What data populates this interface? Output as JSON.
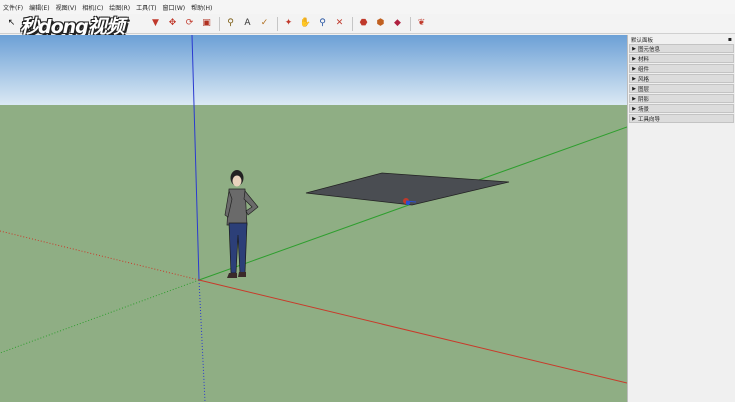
{
  "menubar": {
    "items": [
      {
        "label": "文件(F)"
      },
      {
        "label": "编辑(E)"
      },
      {
        "label": "视图(V)"
      },
      {
        "label": "相机(C)"
      },
      {
        "label": "绘图(R)"
      },
      {
        "label": "工具(T)"
      },
      {
        "label": "窗口(W)"
      },
      {
        "label": "帮助(H)"
      }
    ]
  },
  "toolbar": {
    "tools": [
      {
        "icon": "select-arrow-icon",
        "glyph": "↖"
      },
      {
        "icon": "paint-bucket-icon",
        "glyph": "▼"
      },
      {
        "icon": "eraser-icon",
        "glyph": "▰"
      },
      {
        "icon": "move-icon",
        "glyph": "✥"
      },
      {
        "icon": "rotate-icon",
        "glyph": "⟳"
      },
      {
        "icon": "scale-icon",
        "glyph": "▣"
      },
      {
        "icon": "tape-measure-icon",
        "glyph": "⚲"
      },
      {
        "icon": "text-icon",
        "glyph": "A"
      },
      {
        "icon": "axes-icon",
        "glyph": "✓"
      },
      {
        "icon": "orbit-icon",
        "glyph": "✦"
      },
      {
        "icon": "pan-icon",
        "glyph": "✋"
      },
      {
        "icon": "zoom-icon",
        "glyph": "⚲"
      },
      {
        "icon": "zoom-extents-icon",
        "glyph": "✕"
      },
      {
        "icon": "warehouse-icon",
        "glyph": "⬣"
      },
      {
        "icon": "share-model-icon",
        "glyph": "⬢"
      },
      {
        "icon": "components-icon",
        "glyph": "◆"
      },
      {
        "icon": "extension-warehouse-icon",
        "glyph": "❦"
      }
    ]
  },
  "watermark": {
    "text": "秒dong视频"
  },
  "tray": {
    "title": "默认面板",
    "pin_glyph": "▪",
    "panels": [
      {
        "label": "图元信息"
      },
      {
        "label": "材料"
      },
      {
        "label": "组件"
      },
      {
        "label": "风格"
      },
      {
        "label": "图层"
      },
      {
        "label": "阴影"
      },
      {
        "label": "场景"
      },
      {
        "label": "工具向导"
      }
    ],
    "arrow_glyph": "▶"
  },
  "colors": {
    "sky_top": "#6ca0d6",
    "sky_bottom": "#d9e8f3",
    "ground": "#8fae84",
    "axis_red": "#c83a2a",
    "axis_green": "#2e9e2e",
    "axis_blue": "#2a3ad0",
    "face": "#4a4d52"
  }
}
